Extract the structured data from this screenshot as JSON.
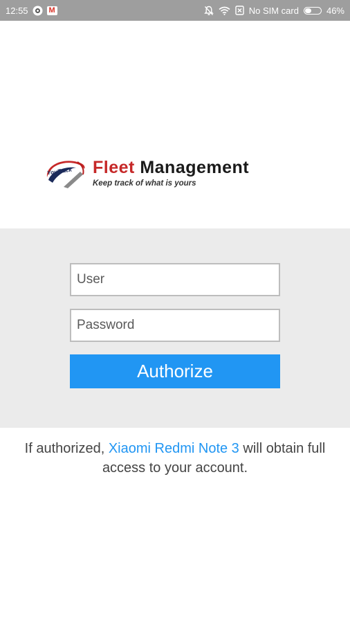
{
  "status_bar": {
    "time": "12:55",
    "carrier": "No SIM card",
    "battery_percent_label": "46%",
    "battery_level": 0.46,
    "icons": [
      "camera-icon",
      "gmail-icon",
      "mute-bell-icon",
      "wifi-icon",
      "no-sim-icon",
      "battery-icon"
    ]
  },
  "logo": {
    "mark_text": "YouTrack",
    "title_word1": "Fleet",
    "title_word2": "Management",
    "tagline": "Keep track of what is yours"
  },
  "form": {
    "user_placeholder": "User",
    "user_value": "",
    "password_placeholder": "Password",
    "password_value": "",
    "authorize_label": "Authorize"
  },
  "message": {
    "prefix": "If authorized, ",
    "app_name": "Xiaomi Redmi Note 3",
    "suffix": " will obtain full access to your account."
  },
  "colors": {
    "accent": "#2196f3",
    "brand_red": "#c62828",
    "status_bar": "#9e9e9e",
    "panel": "#ebebeb"
  }
}
